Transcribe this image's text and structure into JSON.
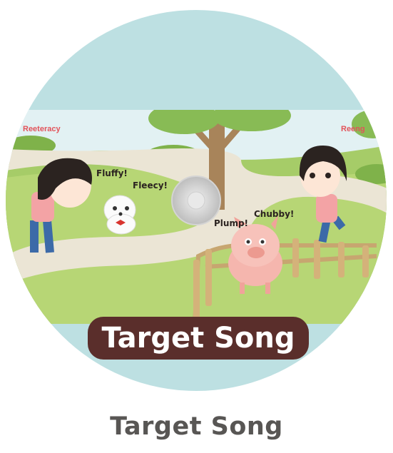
{
  "disc": {
    "title": "Target Song",
    "brand_left": "Reeteracy",
    "brand_right": "Reeng",
    "speech": {
      "dog_1": "Fluffy!",
      "dog_2": "Fleecy!",
      "pig_1": "Plump!",
      "pig_2": "Chubby!"
    }
  },
  "caption": "Target Song",
  "colors": {
    "disc_rim": "#bde0e2",
    "sky": "#e2f1f3",
    "grass": "#b7d675",
    "path": "#ebe5d5",
    "title_bg": "#5a2e2b",
    "caption_text": "#585654"
  }
}
